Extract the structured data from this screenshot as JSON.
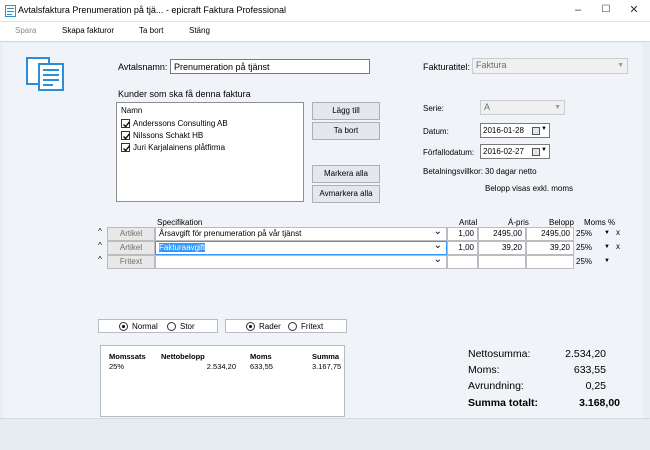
{
  "window": {
    "title": "Avtalsfaktura Prenumeration på tjä... - epicraft Faktura Professional",
    "minimize": "–",
    "maximize": "☐",
    "close": "✕"
  },
  "toolbar": {
    "save": "Spara",
    "create": "Skapa fakturor",
    "delete": "Ta bort",
    "close": "Stäng"
  },
  "agreement": {
    "name_label": "Avtalsnamn:",
    "name_value": "Prenumeration på tjänst",
    "customers_label": "Kunder som ska få denna faktura",
    "list_header": "Namn",
    "customers": [
      {
        "name": "Anderssons Consulting AB",
        "checked": true
      },
      {
        "name": "Nilssons Schakt HB",
        "checked": true
      },
      {
        "name": "Juri Karjalainens plåtfirma",
        "checked": true
      }
    ],
    "add_button": "Lägg till",
    "remove_button": "Ta bort",
    "mark_all_button": "Markera alla",
    "unmark_all_button": "Avmarkera alla"
  },
  "invoice": {
    "title_label": "Fakturatitel:",
    "title_value": "Faktura",
    "series_label": "Serie:",
    "series_value": "A",
    "date_label": "Datum:",
    "date_value": "2016-01-28",
    "due_label": "Förfallodatum:",
    "due_value": "2016-02-27",
    "terms_label": "Betalningsvillkor:",
    "terms_value": "30 dagar netto",
    "price_note": "Belopp visas exkl. moms"
  },
  "grid": {
    "headers": {
      "spec": "Specifikation",
      "qty": "Antal",
      "price": "Á-pris",
      "amount": "Belopp",
      "vat": "Moms %"
    },
    "rows": [
      {
        "type": "Artikel",
        "spec": "Årsavgift för prenumeration på vår tjänst",
        "qty": "1,00",
        "price": "2495,00",
        "amount": "2495,00",
        "vat": "25%",
        "remove": "x",
        "selected": false
      },
      {
        "type": "Artikel",
        "spec": "Fakturaavgift",
        "qty": "1,00",
        "price": "39,20",
        "amount": "39,20",
        "vat": "25%",
        "remove": "x",
        "selected": true
      },
      {
        "type": "Fritext",
        "spec": "",
        "qty": "",
        "price": "",
        "amount": "",
        "vat": "25%",
        "remove": "",
        "selected": false
      }
    ]
  },
  "options": {
    "size": [
      "Normal",
      "Stor"
    ],
    "size_selected": "Normal",
    "mode": [
      "Rader",
      "Fritext"
    ],
    "mode_selected": "Rader"
  },
  "vat_table": {
    "headers": [
      "Momssats",
      "Nettobelopp",
      "Moms",
      "Summa"
    ],
    "rows": [
      [
        "25%",
        "2.534,20",
        "633,55",
        "3.167,75"
      ]
    ]
  },
  "summary": {
    "net_label": "Nettosumma:",
    "net_value": "2.534,20",
    "vat_label": "Moms:",
    "vat_value": "633,55",
    "rounding_label": "Avrundning:",
    "rounding_value": "0,25",
    "total_label": "Summa totalt:",
    "total_value": "3.168,00"
  },
  "colors": {
    "accent": "#3399ff",
    "icon_blue": "#2b8fd6",
    "background": "#f0f3f7"
  },
  "icons": [
    "invoice-app-icon",
    "documents-icon",
    "calendar-icon",
    "chevron-down-icon",
    "chevron-up-icon",
    "checkmark-icon"
  ]
}
